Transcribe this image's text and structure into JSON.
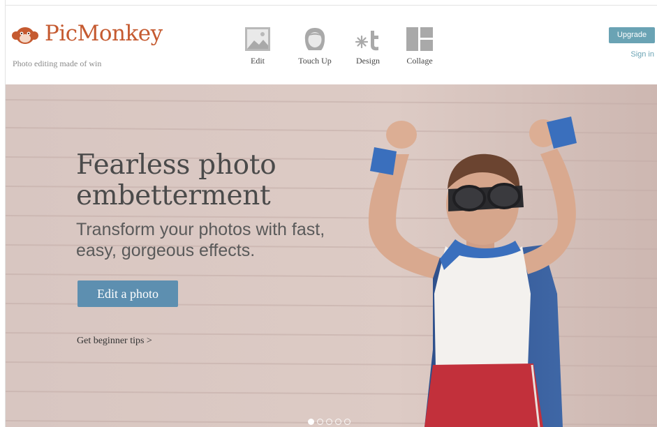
{
  "brand": {
    "name": "PicMonkey",
    "tagline": "Photo editing made of win",
    "color": "#c55a30"
  },
  "nav": {
    "items": [
      {
        "label": "Edit",
        "icon": "image-icon"
      },
      {
        "label": "Touch Up",
        "icon": "face-icon"
      },
      {
        "label": "Design",
        "icon": "design-icon"
      },
      {
        "label": "Collage",
        "icon": "collage-icon"
      }
    ]
  },
  "account": {
    "upgrade_label": "Upgrade",
    "signin_label": "Sign in",
    "accent": "#6aa3b4"
  },
  "hero": {
    "title": "Fearless photo embetterment",
    "subtitle": "Transform your photos with fast, easy, gorgeous effects.",
    "cta_label": "Edit a photo",
    "cta_color": "#5d8fb0",
    "tips_label": "Get beginner tips >",
    "carousel": {
      "count": 5,
      "active": 1
    }
  }
}
